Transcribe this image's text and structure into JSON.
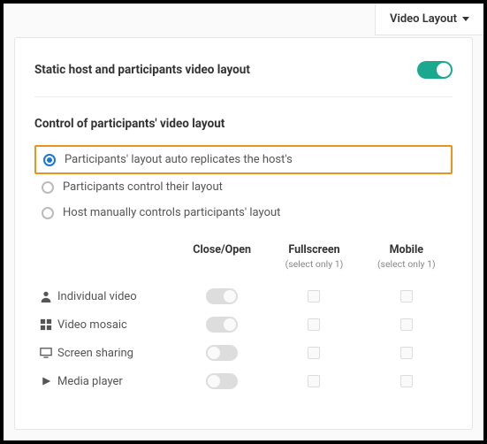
{
  "tab": {
    "label": "Video Layout"
  },
  "static": {
    "title": "Static host and participants video layout",
    "enabled": true
  },
  "control": {
    "title": "Control of participants' video layout",
    "options": [
      "Participants' layout auto replicates the host's",
      "Participants control their layout",
      "Host manually controls participants' layout"
    ]
  },
  "columns": {
    "col1": "Close/Open",
    "col2": "Fullscreen",
    "col2_sub": "(select only 1)",
    "col3": "Mobile",
    "col3_sub": "(select only 1)"
  },
  "rows": [
    {
      "label": "Individual video"
    },
    {
      "label": "Video mosaic"
    },
    {
      "label": "Screen sharing"
    },
    {
      "label": "Media player"
    }
  ]
}
